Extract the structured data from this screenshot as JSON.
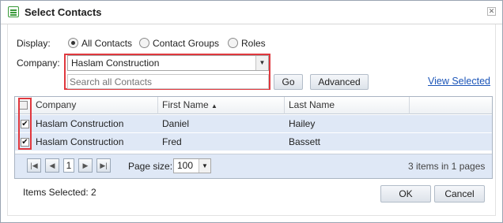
{
  "window": {
    "title": "Select Contacts",
    "close_icon": "close-icon"
  },
  "display": {
    "label": "Display:",
    "options": [
      {
        "label": "All Contacts",
        "selected": true
      },
      {
        "label": "Contact Groups",
        "selected": false
      },
      {
        "label": "Roles",
        "selected": false
      }
    ]
  },
  "company": {
    "label": "Company:",
    "value": "Haslam Construction"
  },
  "search": {
    "placeholder": "Search all Contacts",
    "value": ""
  },
  "buttons": {
    "go": "Go",
    "advanced": "Advanced",
    "ok": "OK",
    "cancel": "Cancel"
  },
  "links": {
    "view_selected": "View Selected"
  },
  "grid": {
    "columns": [
      "Company",
      "First Name",
      "Last Name"
    ],
    "sort": {
      "column": "First Name",
      "direction": "asc"
    },
    "rows": [
      {
        "checked": true,
        "company": "Haslam Construction",
        "first": "Daniel",
        "last": "Hailey"
      },
      {
        "checked": true,
        "company": "Haslam Construction",
        "first": "Fred",
        "last": "Bassett"
      }
    ]
  },
  "pager": {
    "current_page": "1",
    "page_size_label": "Page size:",
    "page_size": "100",
    "summary": "3 items in 1 pages"
  },
  "footer": {
    "items_selected": "Items Selected: 2"
  },
  "colors": {
    "highlight": "#e0383e",
    "row": "#dfe8f6",
    "link": "#1b55b8"
  }
}
